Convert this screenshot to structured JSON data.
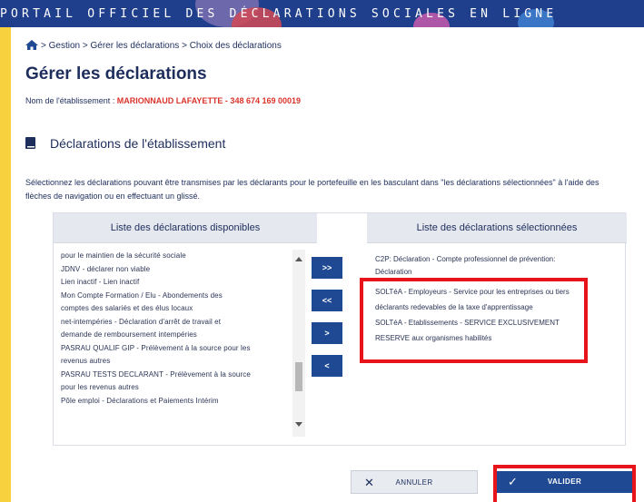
{
  "banner": {
    "text": "PORTAIL OFFICIEL DES DÉCLARATIONS SOCIALES EN LIGNE"
  },
  "breadcrumb": {
    "text": "> Gestion > Gérer les déclarations > Choix des déclarations"
  },
  "page_title": "Gérer les déclarations",
  "establishment": {
    "label": "Nom de l'établissement : ",
    "value": "MARIONNAUD LAFAYETTE - 348 674 169 00019"
  },
  "section_title": "Déclarations de l'établissement",
  "instructions": "Sélectionnez les déclarations pouvant être transmises par les déclarants pour le portefeuille en les basculant dans \"les déclarations sélectionnées\" à l'aide des flèches de navigation ou en effectuant un glissé.",
  "available": {
    "header": "Liste des déclarations disponibles",
    "items": [
      "pour le maintien de la sécurité sociale",
      "JDNV - déclarer non viable",
      "Lien inactif - Lien inactif",
      "Mon Compte Formation / Elu - Abondements des",
      "comptes des salariés et des élus locaux",
      "net-intempéries - Déclaration d'arrêt de travail et",
      "demande de remboursement intempéries",
      "PASRAU QUALIF GIP - Prélèvement à la source pour les",
      "revenus autres",
      "PASRAU TESTS DECLARANT - Prélèvement à la source",
      "pour les revenus autres",
      "Pôle emploi - Déclarations et Paiements Intérim"
    ]
  },
  "selected": {
    "header": "Liste des déclarations sélectionnées",
    "items": [
      "C2P: Déclaration - Compte professionnel de prévention:",
      "Déclaration",
      "SOLTéA - Employeurs - Service pour les entreprises ou tiers",
      "déclarants redevables de la taxe d'apprentissage",
      "SOLTéA - Etablissements - SERVICE EXCLUSIVEMENT",
      "RESERVE aux organismes habilités"
    ]
  },
  "nav_buttons": {
    "add_all": ">>",
    "remove_all": "<<",
    "add": ">",
    "remove": "<"
  },
  "actions": {
    "cancel": "ANNULER",
    "validate": "VALIDER"
  },
  "colors": {
    "banner": "#1f3f8c",
    "primary": "#1f4a93",
    "accent_red": "#d9342b",
    "highlight_red": "#e8141b",
    "frame_yellow": "#f7d23e"
  }
}
